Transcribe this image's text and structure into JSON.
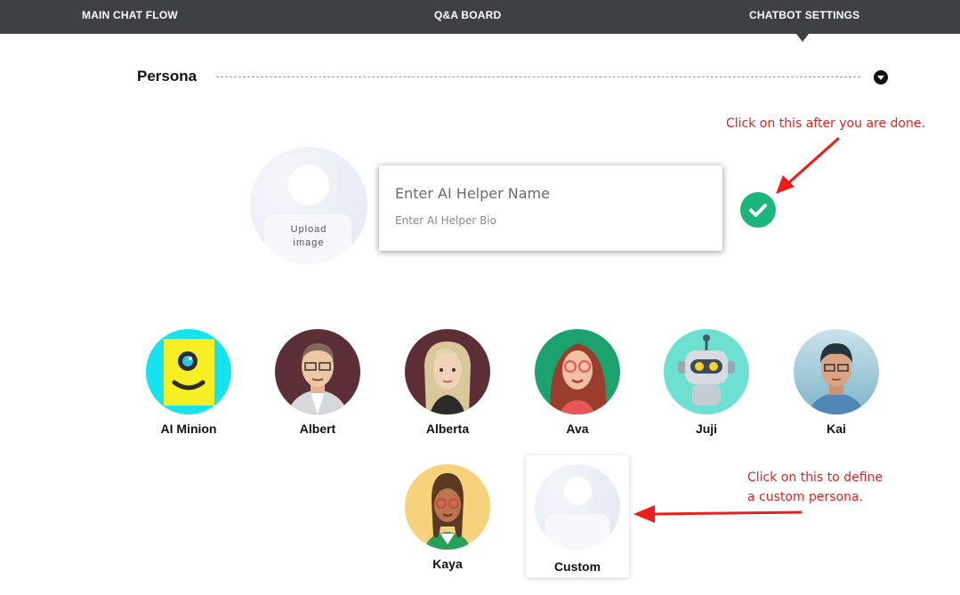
{
  "nav": {
    "tabs": [
      {
        "label": "MAIN CHAT FLOW"
      },
      {
        "label": "Q&A BOARD"
      },
      {
        "label": "CHATBOT SETTINGS",
        "active": true
      }
    ]
  },
  "section": {
    "title": "Persona"
  },
  "editor": {
    "upload_label": "Upload image",
    "name_placeholder": "Enter AI Helper Name",
    "bio_placeholder": "Enter AI Helper Bio"
  },
  "annotations": {
    "done": "Click on this after you are done.",
    "custom_line1": "Click on this to define",
    "custom_line2": "a custom persona."
  },
  "personas": [
    {
      "name": "AI Minion",
      "icon": "minion-avatar-icon"
    },
    {
      "name": "Albert",
      "icon": "albert-avatar-icon"
    },
    {
      "name": "Alberta",
      "icon": "alberta-avatar-icon"
    },
    {
      "name": "Ava",
      "icon": "ava-avatar-icon"
    },
    {
      "name": "Juji",
      "icon": "juji-robot-avatar-icon"
    },
    {
      "name": "Kai",
      "icon": "kai-avatar-icon"
    },
    {
      "name": "Kaya",
      "icon": "kaya-avatar-icon"
    },
    {
      "name": "Custom",
      "icon": "custom-placeholder-avatar-icon",
      "selected": true
    }
  ],
  "colors": {
    "nav_bg": "#3d4045",
    "confirm_green": "#1ab67c",
    "annotation_red": "#ef1c1c"
  }
}
